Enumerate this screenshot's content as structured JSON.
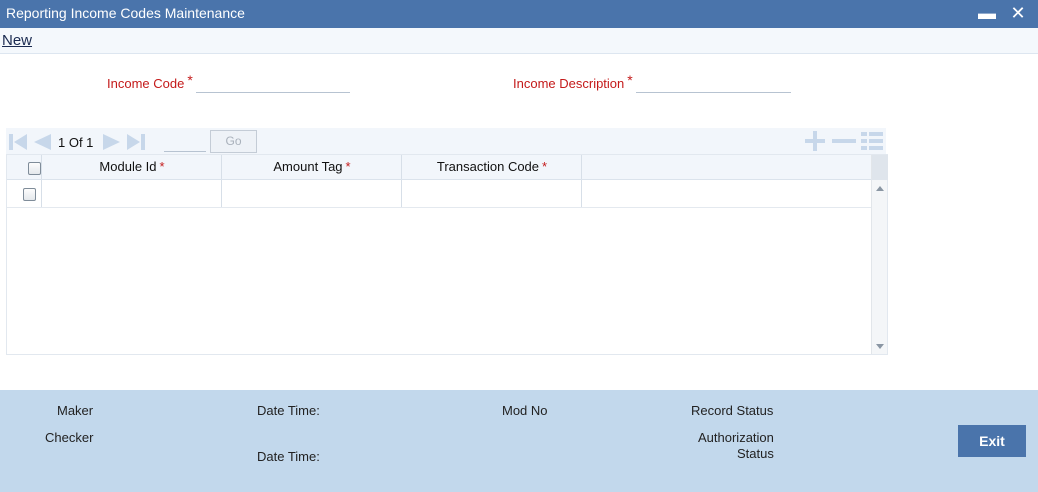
{
  "window": {
    "title": "Reporting Income Codes Maintenance",
    "minimize_glyph": "▬",
    "close_glyph": "✕"
  },
  "menu": {
    "new_label": "New"
  },
  "form": {
    "income_code_label": "Income Code",
    "income_code_value": "",
    "income_description_label": "Income Description",
    "income_description_value": "",
    "required_mark": "*"
  },
  "grid_toolbar": {
    "page_text": "1 Of 1",
    "page_input_value": "",
    "go_label": "Go",
    "icons": [
      "first-page-icon",
      "previous-page-icon",
      "next-page-icon",
      "last-page-icon",
      "add-row-icon",
      "delete-row-icon",
      "single-record-view-icon"
    ]
  },
  "grid": {
    "columns": [
      {
        "label": "Module Id",
        "required": "*"
      },
      {
        "label": "Amount Tag",
        "required": "*"
      },
      {
        "label": "Transaction Code",
        "required": "*"
      }
    ],
    "rows": [
      {
        "module_id": "",
        "amount_tag": "",
        "transaction_code": ""
      }
    ]
  },
  "footer": {
    "maker_label": "Maker",
    "checker_label": "Checker",
    "date_time_label_1": "Date Time:",
    "date_time_label_2": "Date Time:",
    "mod_no_label": "Mod No",
    "record_status_label": "Record Status",
    "authorization_label_line1": "Authorization",
    "authorization_label_line2": "Status",
    "exit_label": "Exit"
  },
  "colors": {
    "title_bar": "#4a74ab",
    "required": "#c41a1a",
    "footer": "#c2d8ec",
    "icon_light": "#c7d7ea"
  }
}
